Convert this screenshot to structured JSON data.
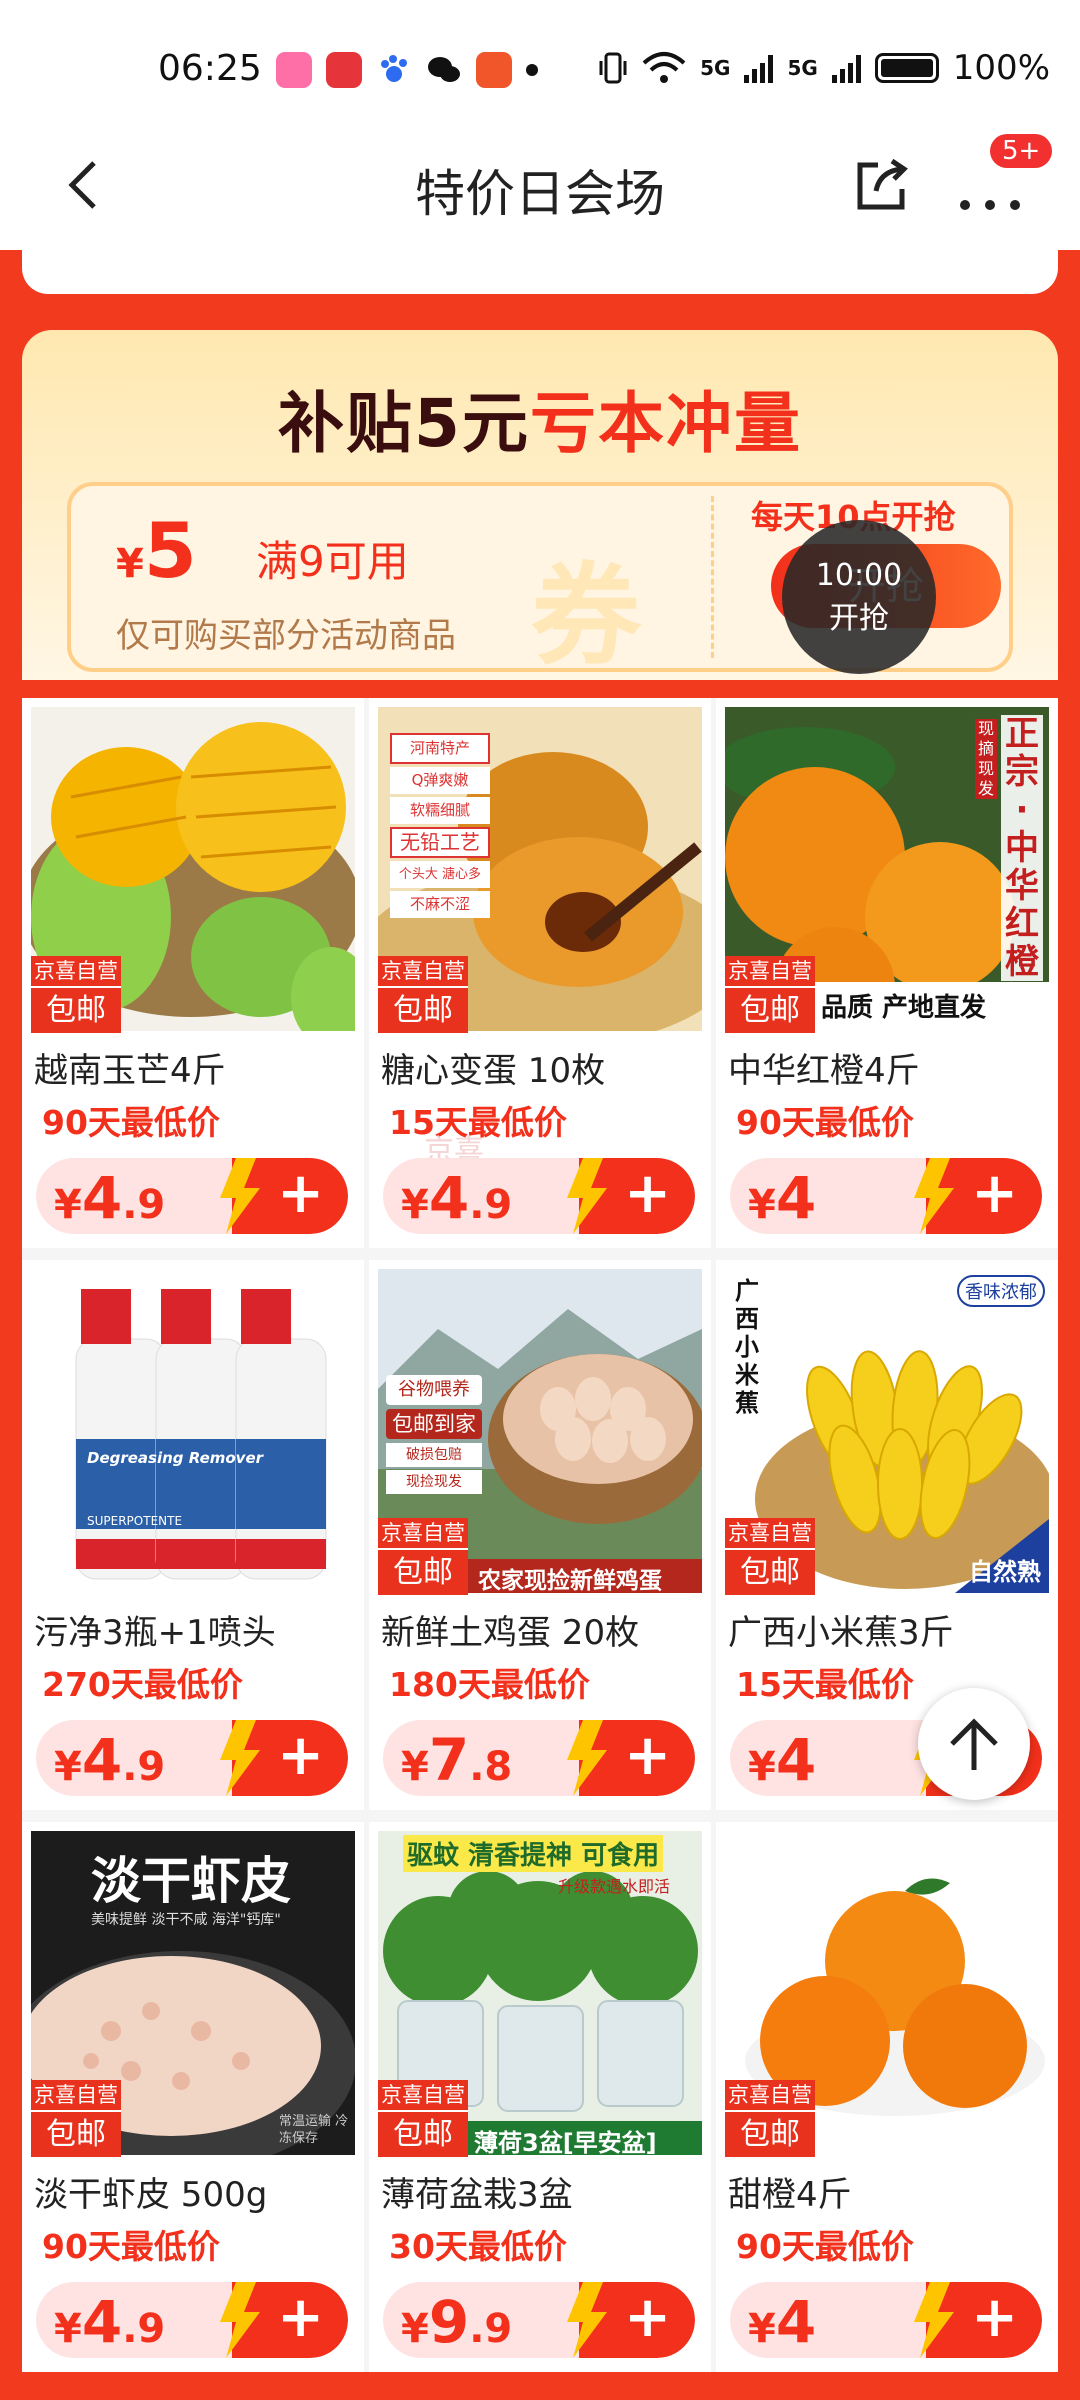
{
  "status": {
    "time": "06:25",
    "battery": "100%",
    "net1": "5G",
    "net2": "5G"
  },
  "nav": {
    "title": "特价日会场",
    "badge": "5+"
  },
  "coupon": {
    "banner_a": "补贴5元",
    "banner_b": "亏本冲量",
    "currency": "¥",
    "amount": "5",
    "condition": "满9可用",
    "note": "仅可购买部分活动商品",
    "stamp": "券",
    "daily": "每天10点开抢",
    "button": "开抢",
    "timer_time": "10:00",
    "timer_label": "开抢"
  },
  "products": [
    {
      "name": "越南玉芒4斤",
      "low": "90天最低价",
      "currency": "¥",
      "price": "4",
      "decimal": ".9",
      "tag1": "京喜自营",
      "tag2": "包邮"
    },
    {
      "name": "糖心变蛋 10枚",
      "low": "15天最低价",
      "currency": "¥",
      "price": "4",
      "decimal": ".9",
      "tag1": "京喜自营",
      "tag2": "包邮"
    },
    {
      "name": "中华红橙4斤",
      "low": "90天最低价",
      "currency": "¥",
      "price": "4",
      "decimal": "",
      "tag1": "京喜自营",
      "tag2": "包邮"
    },
    {
      "name": "污净3瓶+1喷头",
      "low": "270天最低价",
      "currency": "¥",
      "price": "4",
      "decimal": ".9",
      "tag1": "",
      "tag2": ""
    },
    {
      "name": "新鲜土鸡蛋 20枚",
      "low": "180天最低价",
      "currency": "¥",
      "price": "7",
      "decimal": ".8",
      "tag1": "京喜自营",
      "tag2": "包邮"
    },
    {
      "name": "广西小米蕉3斤",
      "low": "15天最低价",
      "currency": "¥",
      "price": "4",
      "decimal": "",
      "tag1": "京喜自营",
      "tag2": "包邮"
    },
    {
      "name": "淡干虾皮 500g",
      "low": "90天最低价",
      "currency": "¥",
      "price": "4",
      "decimal": ".9",
      "tag1": "京喜自营",
      "tag2": "包邮"
    },
    {
      "name": "薄荷盆栽3盆",
      "low": "30天最低价",
      "currency": "¥",
      "price": "9",
      "decimal": ".9",
      "tag1": "京喜自营",
      "tag2": "包邮"
    },
    {
      "name": "甜橙4斤",
      "low": "90天最低价",
      "currency": "¥",
      "price": "4",
      "decimal": "",
      "tag1": "京喜自营",
      "tag2": "包邮"
    }
  ],
  "image_texts": {
    "egg_badges": [
      "河南特产",
      "Q弹爽嫩",
      "软糯细腻",
      "无铅工艺",
      "个头大 溏心多",
      "不麻不涩"
    ],
    "orange_side": "正宗·中华红橙",
    "orange_badge": "现摘现发",
    "orange_strip": "品质 产地直发",
    "chicken_badges": [
      "谷物喂养",
      "包邮到家",
      "破损包赔",
      "现捡现发"
    ],
    "chicken_strip": "农家现捡新鲜鸡蛋",
    "banana_side": "广西小米蕉",
    "banana_top": "香味浓郁",
    "banana_bottom": "自然熟",
    "shrimp_title": "淡干虾皮",
    "shrimp_sub": "美味提鲜 淡干不咸 海洋\"钙库\"",
    "shrimp_note": "常温运输 冷冻保存",
    "mint_top": "驱蚊 清香提神 可食用",
    "mint_sub": "升级款遇水即活",
    "mint_strip": "薄荷3盆[早安盆]",
    "spray_brand": "Degreasing Remover",
    "spray_sub": "SUPERPOTENTE",
    "watermark": "京喜"
  },
  "colors": {
    "accent": "#f2301b",
    "page_bg": "#f23a1e",
    "price_bg": "#ffe3e3"
  }
}
